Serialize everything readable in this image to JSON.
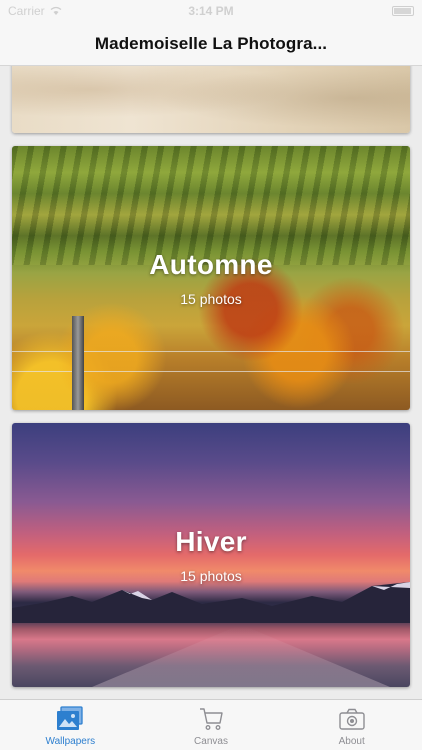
{
  "status_bar": {
    "carrier": "Carrier",
    "time": "3:14 PM"
  },
  "nav": {
    "title": "Mademoiselle La Photogra..."
  },
  "albums": [
    {
      "title": "Automne",
      "count": "15 photos"
    },
    {
      "title": "Hiver",
      "count": "15 photos"
    }
  ],
  "tabs": [
    {
      "label": "Wallpapers",
      "icon": "wallpapers-icon",
      "active": true
    },
    {
      "label": "Canvas",
      "icon": "cart-icon",
      "active": false
    },
    {
      "label": "About",
      "icon": "camera-icon",
      "active": false
    }
  ],
  "colors": {
    "tab_active": "#2d7fcf",
    "tab_inactive": "#8e8e93",
    "bar_bg": "#f7f7f7"
  }
}
